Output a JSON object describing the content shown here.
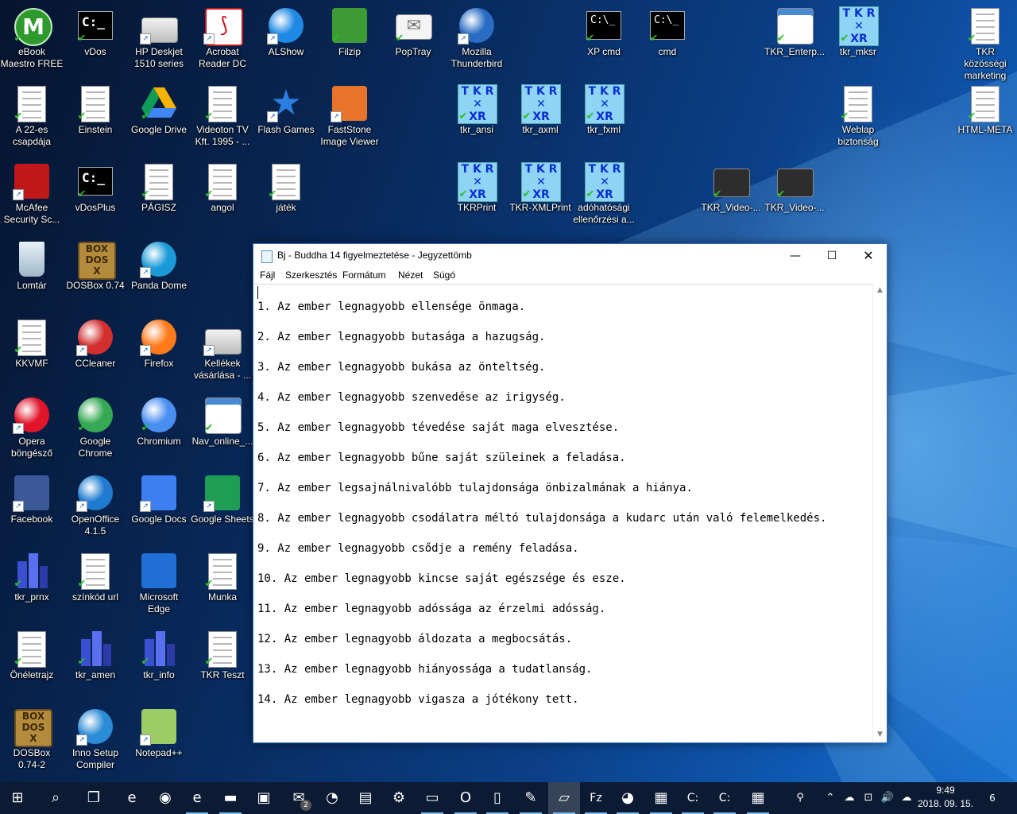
{
  "desktop": {
    "icons": [
      {
        "label": "eBook\nMaestro FREE",
        "art": "circle-m",
        "color": "#2e9a2e",
        "mark": "check"
      },
      {
        "label": "vDos",
        "art": "cmdc",
        "mark": "check"
      },
      {
        "label": "HP Deskjet\n1510 series",
        "art": "printer",
        "mark": "arrow"
      },
      {
        "label": "Acrobat\nReader DC",
        "art": "pdf",
        "color": "#c4161c",
        "mark": "arrow"
      },
      {
        "label": "ALShow",
        "art": "circle",
        "color": "#1e88e5",
        "mark": "arrow"
      },
      {
        "label": "Filzip",
        "art": "tile",
        "color": "#3d9b35",
        "mark": "check"
      },
      {
        "label": "PopTray",
        "art": "envelope",
        "mark": "check"
      },
      {
        "label": "Mozilla\nThunderbird",
        "art": "circle",
        "color": "#2a6cc4",
        "mark": "arrow"
      },
      {
        "label": "XP cmd",
        "art": "cmd",
        "mark": "check"
      },
      {
        "label": "cmd",
        "art": "cmd",
        "mark": "check"
      },
      {
        "label": "TKR_Enterp...",
        "art": "screen",
        "mark": "check"
      },
      {
        "label": "tkr_mksr",
        "art": "tkr",
        "mark": "check"
      },
      {
        "label": "TKR közösségi\nmarketing",
        "art": "doc",
        "mark": "check"
      },
      {
        "label": "A 22-es\ncsapdája",
        "art": "doc",
        "mark": "check"
      },
      {
        "label": "Einstein",
        "art": "doc",
        "mark": "check"
      },
      {
        "label": "Google Drive",
        "art": "drive",
        "mark": "check"
      },
      {
        "label": "Videoton TV\nKft. 1995 - ...",
        "art": "doc",
        "mark": "check"
      },
      {
        "label": "Flash Games",
        "art": "star",
        "mark": "arrow"
      },
      {
        "label": "FastStone\nImage Viewer",
        "art": "tile",
        "color": "#e8732a",
        "mark": "arrow"
      },
      {
        "label": "tkr_ansi",
        "art": "tkr",
        "mark": "check"
      },
      {
        "label": "tkr_axml",
        "art": "tkr",
        "mark": "check"
      },
      {
        "label": "tkr_fxml",
        "art": "tkr",
        "mark": "check"
      },
      {
        "label": "Weblap\nbiztonság",
        "art": "doc",
        "mark": "check"
      },
      {
        "label": "HTML-META",
        "art": "doc",
        "mark": "check"
      },
      {
        "label": "McAfee\nSecurity Sc...",
        "art": "tile",
        "color": "#c01818",
        "mark": "arrow"
      },
      {
        "label": "vDosPlus",
        "art": "cmdc",
        "mark": "check"
      },
      {
        "label": "PÁGISZ",
        "art": "doc",
        "mark": "check"
      },
      {
        "label": "angol",
        "art": "doc",
        "mark": "check"
      },
      {
        "label": "játék",
        "art": "doc",
        "mark": "check"
      },
      {
        "label": "TKRPrint",
        "art": "tkr",
        "mark": "check"
      },
      {
        "label": "TKR-XMLPrint",
        "art": "tkr",
        "mark": "check"
      },
      {
        "label": "adóhatósági\nellenőrzési a...",
        "art": "tkr",
        "mark": "check"
      },
      {
        "label": "TKR_Video-...",
        "art": "video",
        "mark": "check"
      },
      {
        "label": "TKR_Video-...",
        "art": "video",
        "mark": "check"
      },
      {
        "label": "Lomtár",
        "art": "bin",
        "mark": "none"
      },
      {
        "label": "DOSBox 0.74",
        "art": "dosbox",
        "mark": "none"
      },
      {
        "label": "Panda Dome",
        "art": "circle",
        "color": "#1a9bd7",
        "mark": "arrow"
      },
      {
        "label": "KKVMF",
        "art": "doc",
        "mark": "check"
      },
      {
        "label": "CCleaner",
        "art": "circle",
        "color": "#d32f2f",
        "mark": "arrow"
      },
      {
        "label": "Firefox",
        "art": "circle",
        "color": "#ff7a1a",
        "mark": "arrow"
      },
      {
        "label": "Kellékek\nvásárlása - ...",
        "art": "printer",
        "mark": "arrow"
      },
      {
        "label": "Opera\nböngésző",
        "art": "circle",
        "color": "#e0152b",
        "mark": "arrow"
      },
      {
        "label": "Google\nChrome",
        "art": "circle",
        "color": "#34a853",
        "mark": "check"
      },
      {
        "label": "Chromium",
        "art": "circle",
        "color": "#4a8ef0",
        "mark": "check"
      },
      {
        "label": "Nav_online_...",
        "art": "screen",
        "mark": "check"
      },
      {
        "label": "Facebook",
        "art": "tile",
        "color": "#3b5998",
        "mark": "arrow"
      },
      {
        "label": "OpenOffice\n4.1.5",
        "art": "circle",
        "color": "#1e7bd0",
        "mark": "arrow"
      },
      {
        "label": "Google Docs",
        "art": "tile",
        "color": "#3d7ff0",
        "mark": "arrow"
      },
      {
        "label": "Google Sheets",
        "art": "tile",
        "color": "#1f9d55",
        "mark": "arrow"
      },
      {
        "label": "tkr_prnx",
        "art": "building",
        "mark": "check"
      },
      {
        "label": "színkód url",
        "art": "doc",
        "mark": "check"
      },
      {
        "label": "Microsoft\nEdge",
        "art": "tile",
        "color": "#1f6fd6",
        "mark": "none"
      },
      {
        "label": "Munka",
        "art": "doc",
        "mark": "check"
      },
      {
        "label": "Önéletrajz",
        "art": "doc",
        "mark": "check"
      },
      {
        "label": "tkr_amen",
        "art": "building",
        "mark": "check"
      },
      {
        "label": "tkr_info",
        "art": "building",
        "mark": "check"
      },
      {
        "label": "TKR Teszt",
        "art": "doc",
        "mark": "check"
      },
      {
        "label": "DOSBox\n0.74-2",
        "art": "dosbox",
        "mark": "none"
      },
      {
        "label": "Inno Setup\nCompiler",
        "art": "circle",
        "color": "#2a8bd6",
        "mark": "arrow"
      },
      {
        "label": "Notepad++",
        "art": "tile",
        "color": "#9ccc65",
        "mark": "arrow"
      }
    ]
  },
  "notepad": {
    "title": "Bj - Buddha 14 figyelmeztetése - Jegyzettömb",
    "menu": [
      "Fájl",
      "Szerkesztés",
      "Formátum",
      "Nézet",
      "Súgó"
    ],
    "lines": [
      "1. Az ember legnagyobb ellensége önmaga.",
      "2. Az ember legnagyobb butasága a hazugság.",
      "3. Az ember legnagyobb bukása az önteltség.",
      "4. Az ember legnagyobb szenvedése az irigység.",
      "5. Az ember legnagyobb tévedése saját maga elvesztése.",
      "6. Az ember legnagyobb bűne saját szüleinek a feladása.",
      "7. Az ember legsajnálnivalóbb tulajdonsága önbizalmának a hiánya.",
      "8. Az ember legnagyobb csodálatra méltó tulajdonsága a kudarc után való felemelkedés.",
      "9. Az ember legnagyobb csődje a remény feladása.",
      "10. Az ember legnagyobb kincse saját egészsége és esze.",
      "11. Az ember legnagyobb adóssága az érzelmi adósság.",
      "12. Az ember legnagyobb áldozata a megbocsátás.",
      "13. Az ember legnagyobb hiányossága a tudatlanság.",
      "14. Az ember legnagyobb vigasza a jótékony tett."
    ]
  },
  "taskbar": {
    "items": [
      {
        "name": "start-button",
        "glyph": "⊞"
      },
      {
        "name": "search-icon",
        "glyph": "⌕"
      },
      {
        "name": "task-view-icon",
        "glyph": "❐"
      },
      {
        "name": "edge-icon",
        "glyph": "e"
      },
      {
        "name": "chrome-icon",
        "glyph": "◉"
      },
      {
        "name": "ie-icon",
        "glyph": "e"
      },
      {
        "name": "file-explorer-icon",
        "glyph": "▬"
      },
      {
        "name": "store-icon",
        "glyph": "▣"
      },
      {
        "name": "mail-icon",
        "glyph": "✉"
      },
      {
        "name": "thunderbird-icon",
        "glyph": "◔"
      },
      {
        "name": "contacts-icon",
        "glyph": "▤"
      },
      {
        "name": "settings-icon",
        "glyph": "⚙"
      },
      {
        "name": "cmd-icon",
        "glyph": "▭"
      },
      {
        "name": "opera-icon",
        "glyph": "O"
      },
      {
        "name": "document-icon",
        "glyph": "▯"
      },
      {
        "name": "paint-icon",
        "glyph": "✎"
      },
      {
        "name": "notepad-icon",
        "glyph": "▱"
      },
      {
        "name": "filezilla-icon",
        "glyph": "Fz"
      },
      {
        "name": "firefox-icon",
        "glyph": "◕"
      },
      {
        "name": "dosbox-icon",
        "glyph": "▦"
      },
      {
        "name": "vdos-icon",
        "glyph": "C:"
      },
      {
        "name": "vdosplus-icon",
        "glyph": "C:"
      },
      {
        "name": "calculator-icon",
        "glyph": "▦"
      }
    ],
    "mail_badge": "2",
    "tray": [
      "⚲",
      "⌃",
      "☁",
      "⊡",
      "🔊",
      "☁"
    ],
    "time": "9:49",
    "date": "2018. 09. 15.",
    "notifications": "6",
    "colors": {
      "accent": "#76b9ed",
      "bar": "#0c1a33"
    }
  }
}
